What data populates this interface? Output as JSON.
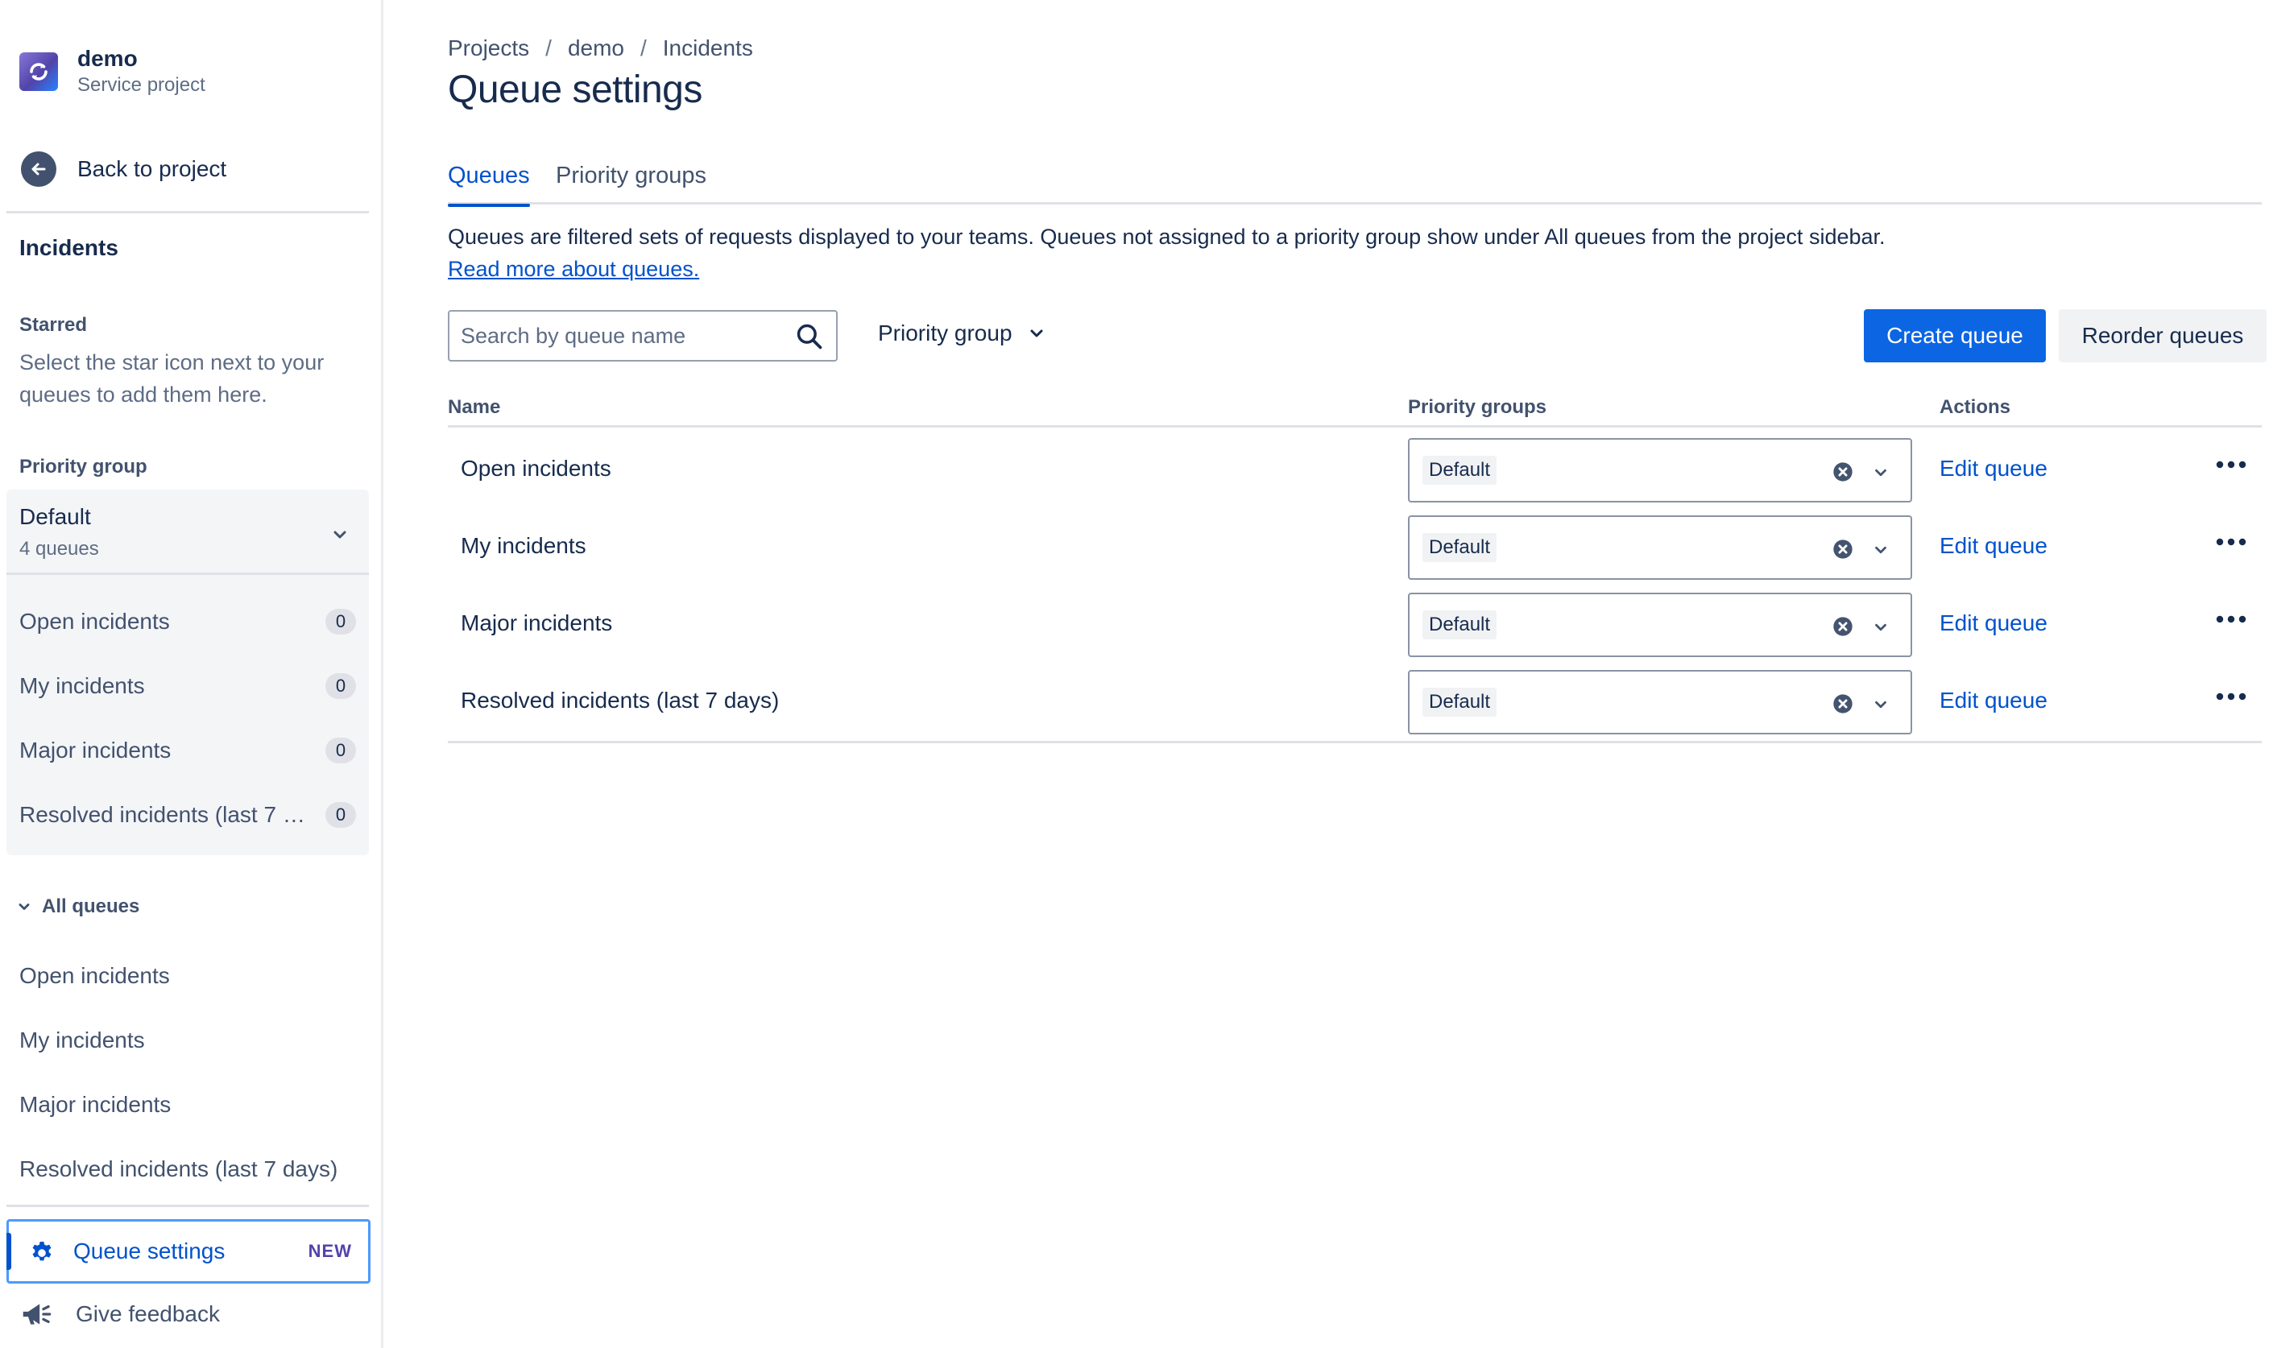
{
  "project": {
    "name": "demo",
    "type": "Service project"
  },
  "sidebar": {
    "back_label": "Back to project",
    "section_title": "Incidents",
    "starred": {
      "title": "Starred",
      "hint": "Select the star icon next to your queues to add them here."
    },
    "priority_group": {
      "title": "Priority group",
      "selected": "Default",
      "count_label": "4 queues",
      "queues": [
        {
          "label": "Open incidents",
          "count": "0"
        },
        {
          "label": "My incidents",
          "count": "0"
        },
        {
          "label": "Major incidents",
          "count": "0"
        },
        {
          "label": "Resolved incidents (last 7 days)",
          "count": "0"
        }
      ]
    },
    "all_queues": {
      "title": "All queues",
      "items": [
        "Open incidents",
        "My incidents",
        "Major incidents",
        "Resolved incidents (last 7 days)"
      ]
    },
    "queue_settings": {
      "label": "Queue settings",
      "badge": "NEW"
    },
    "feedback_label": "Give feedback"
  },
  "breadcrumbs": [
    "Projects",
    "demo",
    "Incidents"
  ],
  "page_title": "Queue settings",
  "tabs": [
    {
      "label": "Queues",
      "active": true
    },
    {
      "label": "Priority groups",
      "active": false
    }
  ],
  "description": "Queues are filtered sets of requests displayed to your teams. Queues not assigned to a priority group show under All queues from the project sidebar.",
  "read_more": "Read more about queues.",
  "search": {
    "placeholder": "Search by queue name",
    "value": ""
  },
  "filter": {
    "label": "Priority group"
  },
  "buttons": {
    "create": "Create queue",
    "reorder": "Reorder queues"
  },
  "table": {
    "headers": {
      "name": "Name",
      "priority_groups": "Priority groups",
      "actions": "Actions"
    },
    "rows": [
      {
        "name": "Open incidents",
        "group": "Default",
        "action": "Edit queue"
      },
      {
        "name": "My incidents",
        "group": "Default",
        "action": "Edit queue"
      },
      {
        "name": "Major incidents",
        "group": "Default",
        "action": "Edit queue"
      },
      {
        "name": "Resolved incidents (last 7 days)",
        "group": "Default",
        "action": "Edit queue"
      }
    ]
  },
  "icons": {
    "project_logo": "project-logo-icon",
    "back": "arrow-left-icon",
    "chevron": "chevron-down-icon",
    "settings": "gear-icon",
    "feedback": "megaphone-icon",
    "search": "search-icon",
    "clear": "clear-icon",
    "more": "more-icon"
  },
  "colors": {
    "primary": "#0c66e4",
    "link": "#0052cc",
    "text": "#172b4d",
    "subtle": "#42526e",
    "new_badge": "#5243aa"
  }
}
